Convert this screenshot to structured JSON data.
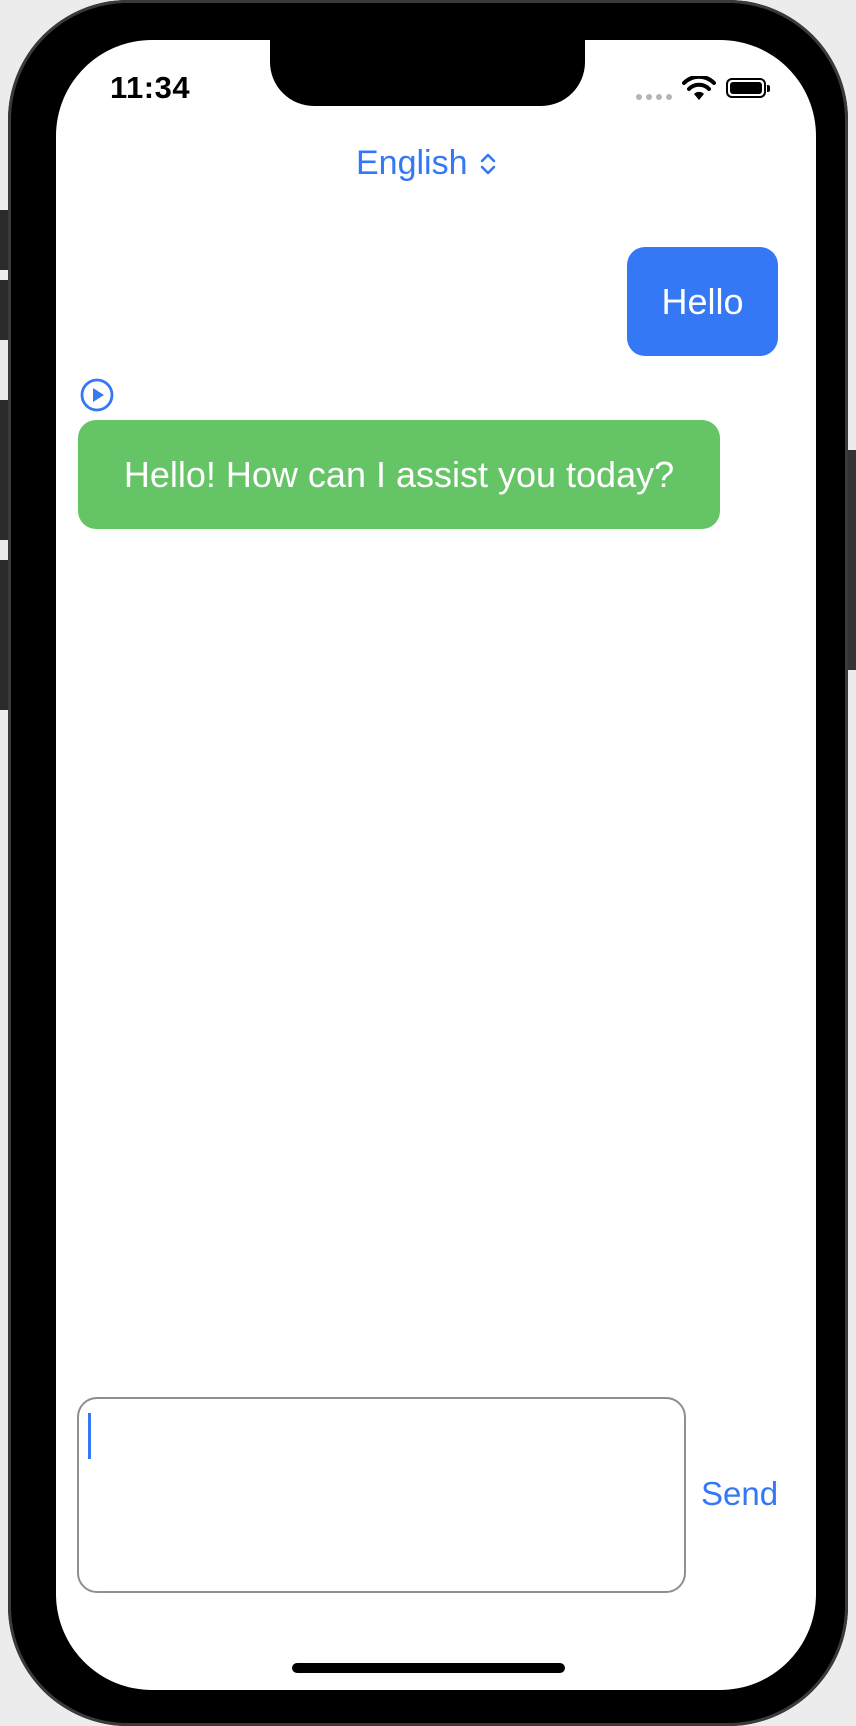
{
  "status_bar": {
    "time": "11:34",
    "icons": [
      "cellular-dots-icon",
      "wifi-icon",
      "battery-icon"
    ]
  },
  "header": {
    "language": "English",
    "language_icon": "chevron-up-down-icon"
  },
  "messages": [
    {
      "role": "user",
      "text": "Hello",
      "color": "#3478f6"
    },
    {
      "role": "assistant",
      "text": "Hello! How can I assist you today?",
      "color": "#65c466",
      "icon": "play-circle-icon"
    }
  ],
  "composer": {
    "value": "",
    "send_label": "Send"
  },
  "colors": {
    "accent": "#3478f6",
    "assistant_bubble": "#65c466"
  }
}
